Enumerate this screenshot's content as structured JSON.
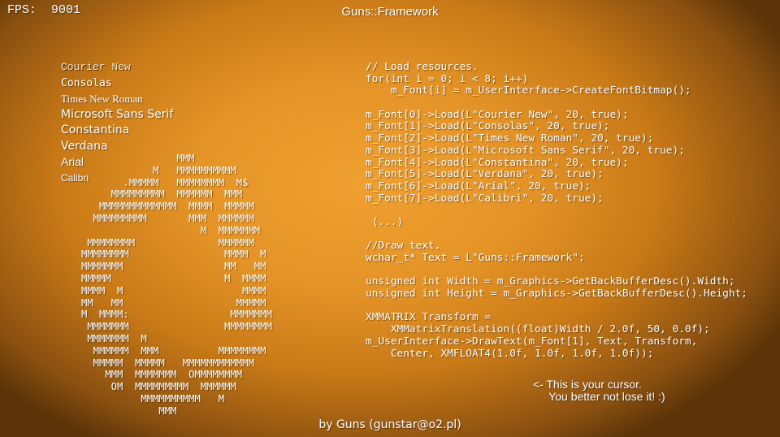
{
  "hud": {
    "fps_label": "FPS:",
    "fps_value": "9001"
  },
  "window_title": "Guns::Framework",
  "font_samples": [
    "Courier New",
    "Consolas",
    "Times New Roman",
    "Microsoft Sans Serif",
    "Constantina",
    "Verdana",
    "Arial",
    "Calibri"
  ],
  "ascii_art": "                MMM\n            M   MMMMMMMMMM\n       .MMMMM   MMMMMMMM  M$\n     MMMMMMMMM  MMMMMM  MMM\n   MMMMMMMMMMMMM  MMMM  MMMMM\n  MMMMMMMMM       MMM  MMMMMM\n                    M  MMMMMMM\n MMMMMMMM              MMMMMM\nMMMMMMMM                MMMM  M\nMMMMMMM                 MM   MM\nMMMMM                   M  MMMM\nMMMM  M                    MMMM\nMM   MM                   MMMMM\nM  MMMM:                 MMMMMMM\n MMMMMMM                MMMMMMMM\n MMMMMMM  M\n  MMMMMM  MMM          MMMMMMMM\n  MMMMM  MMMMM   MMMMMMMMMMMM\n    MMM  MMMMMMM  OMMMMMMMM\n     OM  MMMMMMMMM  MMMMMM\n          MMMMMMMMMM   M\n             MMM",
  "code_lines": [
    "// Load resources.",
    "for(int i = 0; i < 8; i++)",
    "    m_Font[i] = m_UserInterface->CreateFontBitmap();",
    "",
    "m_Font[0]->Load(L\"Courier New\", 20, true);",
    "m_Font[1]->Load(L\"Consolas\", 20, true);",
    "m_Font[2]->Load(L\"Times New Roman\", 20, true);",
    "m_Font[3]->Load(L\"Microsoft Sans Serif\", 20, true);",
    "m_Font[4]->Load(L\"Constantina\", 20, true);",
    "m_Font[5]->Load(L\"Verdana\", 20, true);",
    "m_Font[6]->Load(L\"Arial\", 20, true);",
    "m_Font[7]->Load(L\"Calibri\", 20, true);",
    "",
    " (...)",
    "",
    "//Draw text.",
    "wchar_t* Text = L\"Guns::Framework\";",
    "",
    "unsigned int Width = m_Graphics->GetBackBufferDesc().Width;",
    "unsigned int Height = m_Graphics->GetBackBufferDesc().Height;",
    "",
    "XMMATRIX Transform =",
    "    XMMatrixTranslation((float)Width / 2.0f, 50, 0.0f);",
    "m_UserInterface->DrawText(m_Font[1], Text, Transform,",
    "    Center, XMFLOAT4(1.0f, 1.0f, 1.0f, 1.0f));"
  ],
  "cursor_note": "<- This is your cursor.\n     You better not lose it! :)",
  "footer": "by Guns (gunstar@o2.pl)"
}
